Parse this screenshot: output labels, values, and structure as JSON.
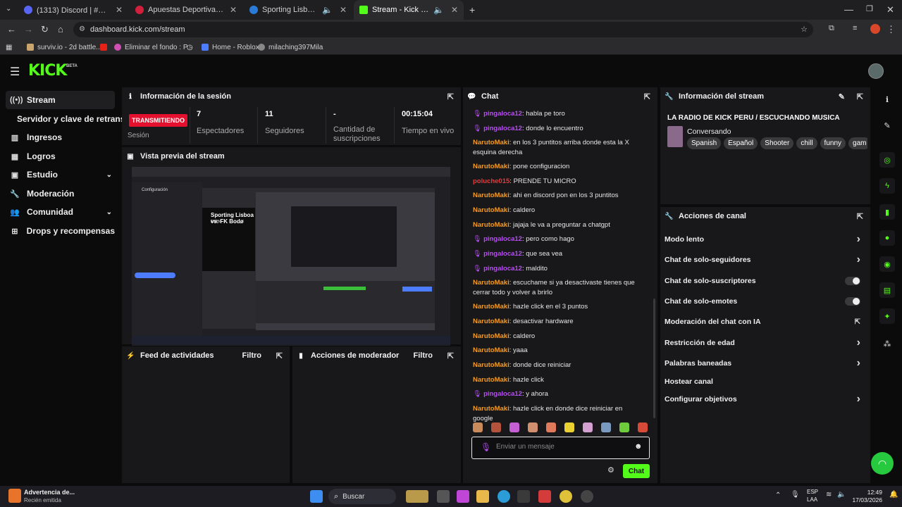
{
  "browser": {
    "tabs": [
      {
        "title": "(1313) Discord | #💬|Chat-Ge",
        "color": "#5865f2"
      },
      {
        "title": "Apuestas Deportivas Online | Ap",
        "color": "#d21f3c"
      },
      {
        "title": "Sporting Lisboa vs. FK Bod",
        "color": "#2a7bd8"
      },
      {
        "title": "Stream - Kick Dashboard",
        "color": "#53fc18"
      }
    ],
    "url": "dashboard.kick.com/stream",
    "bookmarks": [
      "surviv.io - 2d battle...",
      "Eliminar el fondo : P...",
      "Home - Roblox",
      "milaching397Mila"
    ]
  },
  "kick": {
    "logo": "KICK",
    "beta": "BETA"
  },
  "sidebar": {
    "items": [
      {
        "label": "Stream",
        "icon": "broadcast-icon"
      },
      {
        "label": "Servidor y clave de retransmisión",
        "icon": ""
      },
      {
        "label": "Ingresos",
        "icon": "revenue-icon"
      },
      {
        "label": "Logros",
        "icon": "trophy-icon"
      },
      {
        "label": "Estudio",
        "icon": "studio-icon"
      },
      {
        "label": "Moderación",
        "icon": "wrench-icon"
      },
      {
        "label": "Comunidad",
        "icon": "community-icon"
      },
      {
        "label": "Drops y recompensas",
        "icon": "drops-icon"
      }
    ]
  },
  "session": {
    "title": "Información de la sesión",
    "badge": "TRANSMITIENDO",
    "session_label": "Sesión",
    "stats": [
      {
        "value": "7",
        "label": "Espectadores"
      },
      {
        "value": "11",
        "label": "Seguidores"
      },
      {
        "value": "-",
        "label": "Cantidad de suscripciones"
      },
      {
        "value": "00:15:04",
        "label": "Tiempo en vivo"
      }
    ]
  },
  "preview": {
    "title": "Vista previa del stream",
    "inner_settings": "Configuración",
    "inner_match": "Sporting Lisboa vs. FK Bodø",
    "inner_channel": "ESPN"
  },
  "activity": {
    "title": "Feed de actividades",
    "filter": "Filtro"
  },
  "modactions": {
    "title": "Acciones de moderador",
    "filter": "Filtro"
  },
  "chat": {
    "title": "Chat",
    "messages": [
      {
        "user": "pingaloca12",
        "text": "habla pe toro",
        "color": "#b84df5",
        "mic": true
      },
      {
        "user": "pingaloca12",
        "text": "donde lo encuentro",
        "color": "#b84df5",
        "mic": true
      },
      {
        "user": "NarutoMaki",
        "text": "en los 3 puntitos arriba donde esta la X esquina derecha",
        "color": "#f39c26",
        "mic": false
      },
      {
        "user": "NarutoMaki",
        "text": "pone configuracion",
        "color": "#f39c26",
        "mic": false
      },
      {
        "user": "poluche015",
        "text": "PRENDE TU MICRO",
        "color": "#e23c3c",
        "mic": false
      },
      {
        "user": "NarutoMaki",
        "text": "ahi en discord pon en los 3 puntitos",
        "color": "#f39c26",
        "mic": false
      },
      {
        "user": "NarutoMaki",
        "text": "caldero",
        "color": "#f39c26",
        "mic": false
      },
      {
        "user": "NarutoMaki",
        "text": "jajaja le va a preguntar a chatgpt",
        "color": "#f39c26",
        "mic": false
      },
      {
        "user": "pingaloca12",
        "text": "pero como hago",
        "color": "#b84df5",
        "mic": true
      },
      {
        "user": "pingaloca12",
        "text": "que sea vea",
        "color": "#b84df5",
        "mic": true
      },
      {
        "user": "pingaloca12",
        "text": "maldito",
        "color": "#b84df5",
        "mic": true
      },
      {
        "user": "NarutoMaki",
        "text": "escuchame si ya desactivaste tienes que cerrar todo y volver a brirlo",
        "color": "#f39c26",
        "mic": false
      },
      {
        "user": "NarutoMaki",
        "text": "hazle click en el 3 puntos",
        "color": "#f39c26",
        "mic": false
      },
      {
        "user": "NarutoMaki",
        "text": "desactivar hardware",
        "color": "#f39c26",
        "mic": false
      },
      {
        "user": "NarutoMaki",
        "text": "caldero",
        "color": "#f39c26",
        "mic": false
      },
      {
        "user": "NarutoMaki",
        "text": "yaaa",
        "color": "#f39c26",
        "mic": false
      },
      {
        "user": "NarutoMaki",
        "text": "donde dice reiniciar",
        "color": "#f39c26",
        "mic": false
      },
      {
        "user": "NarutoMaki",
        "text": "hazle click",
        "color": "#f39c26",
        "mic": false
      },
      {
        "user": "pingaloca12",
        "text": "y ahora",
        "color": "#b84df5",
        "mic": true
      },
      {
        "user": "NarutoMaki",
        "text": "hazle click en donde dice reiniciar en google",
        "color": "#f39c26",
        "mic": false
      }
    ],
    "placeholder": "Enviar un mensaje",
    "send_label": "Chat"
  },
  "stream_info": {
    "title": "Información del stream",
    "stream_title": "LA RADIO DE KICK PERU / ESCUCHANDO MUSICA",
    "category": "Conversando",
    "tags": [
      "Spanish",
      "Español",
      "Shooter",
      "chill",
      "funny",
      "gam"
    ]
  },
  "channel_actions": {
    "title": "Acciones de canal",
    "items": [
      {
        "label": "Modo lento",
        "kind": "chevron"
      },
      {
        "label": "Chat de solo-seguidores",
        "kind": "chevron"
      },
      {
        "label": "Chat de solo-suscriptores",
        "kind": "toggle"
      },
      {
        "label": "Chat de solo-emotes",
        "kind": "toggle"
      },
      {
        "label": "Moderación del chat con IA",
        "kind": "external"
      },
      {
        "label": "Restricción de edad",
        "kind": "chevron"
      },
      {
        "label": "Palabras baneadas",
        "kind": "chevron"
      },
      {
        "label": "Hostear canal",
        "kind": "none"
      },
      {
        "label": "Configurar objetivos",
        "kind": "chevron"
      }
    ]
  },
  "taskbar": {
    "notif_title": "Advertencia de...",
    "notif_sub": "Recién emitida",
    "search": "Buscar",
    "lang": "ESP",
    "lang2": "LAA",
    "time": "12:49",
    "date": "17/03/2026"
  },
  "colors": {
    "accent": "#53fc18",
    "live": "#e4102d",
    "panel": "#18181a"
  }
}
